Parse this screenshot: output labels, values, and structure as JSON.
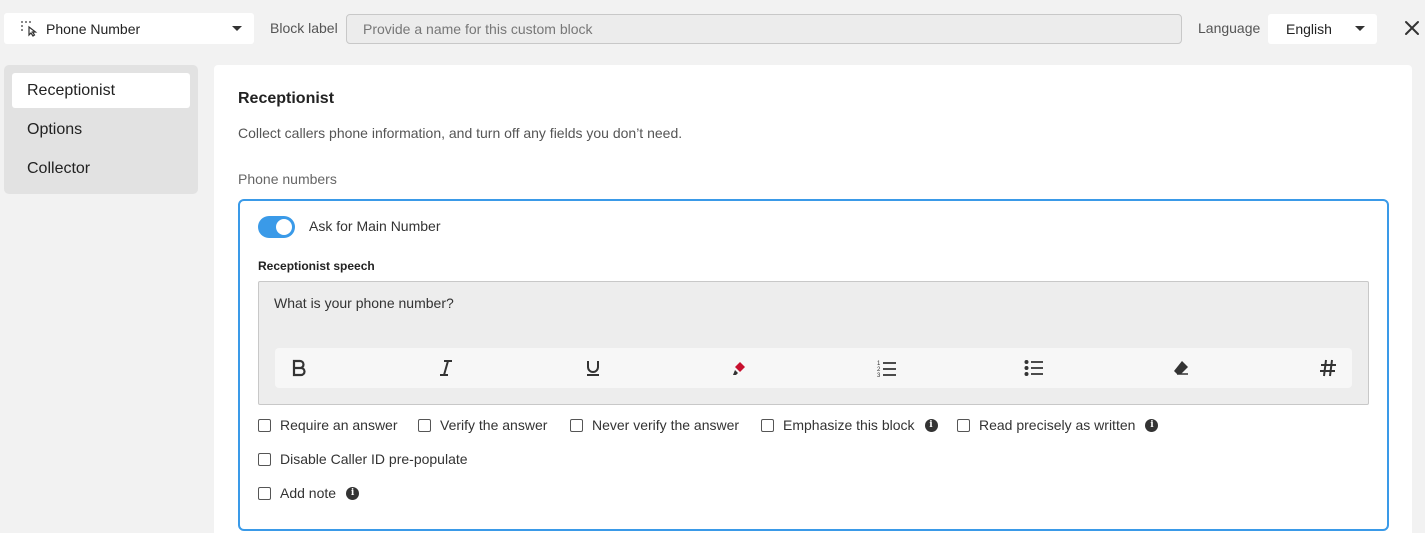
{
  "header": {
    "block_type": "Phone Number",
    "block_label_text": "Block label",
    "block_label_placeholder": "Provide a name for this custom block",
    "block_label_value": "",
    "language_text": "Language",
    "language_value": "English"
  },
  "sidebar": {
    "items": [
      {
        "label": "Receptionist",
        "active": true
      },
      {
        "label": "Options",
        "active": false
      },
      {
        "label": "Collector",
        "active": false
      }
    ]
  },
  "main": {
    "title": "Receptionist",
    "description": "Collect callers phone information, and turn off any fields you don’t need.",
    "section_label": "Phone numbers",
    "card": {
      "toggle_label": "Ask for Main Number",
      "toggle_on": true,
      "speech_label": "Receptionist speech",
      "speech_text": "What is your phone number?",
      "toolbar": [
        "bold-icon",
        "italic-icon",
        "underline-icon",
        "highlighter-icon",
        "ordered-list-icon",
        "bullet-list-icon",
        "eraser-icon",
        "hash-icon"
      ],
      "checkboxes": {
        "require_answer": "Require an answer",
        "verify_answer": "Verify the answer",
        "never_verify": "Never verify the answer",
        "emphasize": "Emphasize this block",
        "read_precisely": "Read precisely as written",
        "disable_caller_id": "Disable Caller ID pre-populate",
        "add_note": "Add note"
      }
    }
  },
  "colors": {
    "accent": "#3a9ae8",
    "highlighter": "#c8102e"
  }
}
